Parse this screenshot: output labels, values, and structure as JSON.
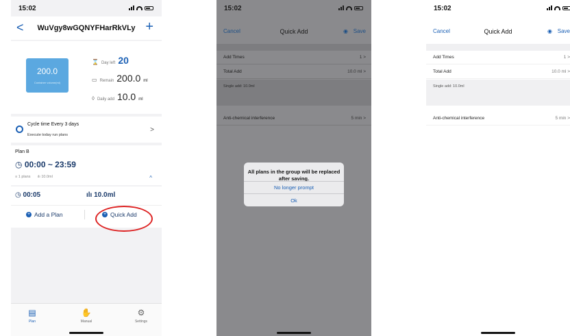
{
  "screen1": {
    "status_time": "15:02",
    "nav": {
      "back": "<",
      "title": "WuVgy8wGQNYFHarRkVLy",
      "add": "+"
    },
    "container": {
      "value": "200.0",
      "label": "Container volume(ml)"
    },
    "stats": {
      "day_left_label": "Day left",
      "day_left_value": "20",
      "remain_label": "Remain",
      "remain_value": "200.0",
      "remain_unit": "ml",
      "daily_label": "Daily add",
      "daily_value": "10.0",
      "daily_unit": "ml"
    },
    "cycle": {
      "title": "Cycle time   Every 3 days",
      "subtitle": "Execute today run plans",
      "chevron": ">"
    },
    "plan": {
      "name": "Plan B",
      "time_range": "00:00 ~ 23:59",
      "plans_count": "1 plans",
      "volume": "10.0ml",
      "caret": "^"
    },
    "entry": {
      "time": "00:05",
      "volume": "10.0ml"
    },
    "buttons": {
      "add_plan": "Add a Plan",
      "quick_add": "Quick Add"
    },
    "tabs": [
      {
        "label": "Plan",
        "icon": "calendar-icon"
      },
      {
        "label": "Manual",
        "icon": "hand-icon"
      },
      {
        "label": "Settings",
        "icon": "gear-icon"
      }
    ]
  },
  "screen2": {
    "status_time": "15:02",
    "nav": {
      "cancel": "Cancel",
      "title": "Quick Add",
      "save": "Save"
    },
    "rows": [
      {
        "label": "Add Times",
        "value": "1 >"
      },
      {
        "label": "Total Add",
        "value": "10.0 ml >"
      }
    ],
    "note": "Single add: 10.0ml",
    "interference": {
      "label": "Anti-chemical interference",
      "value": "5 min >"
    },
    "dialog": {
      "message": "All plans in the group will be replaced after saving.",
      "option1": "No longer prompt",
      "option2": "Ok"
    }
  },
  "screen3": {
    "status_time": "15:02",
    "nav": {
      "cancel": "Cancel",
      "title": "Quick Add",
      "save": "Save"
    },
    "rows": [
      {
        "label": "Add Times",
        "value": "1 >"
      },
      {
        "label": "Total Add",
        "value": "10.0 ml >"
      }
    ],
    "note": "Single add: 10.0ml",
    "interference": {
      "label": "Anti-chemical interference",
      "value": "5 min >"
    }
  },
  "colors": {
    "accent": "#1a5fb4",
    "container": "#5ba8e0",
    "highlight": "#dd2222",
    "overlay": "#8a8a8d"
  }
}
